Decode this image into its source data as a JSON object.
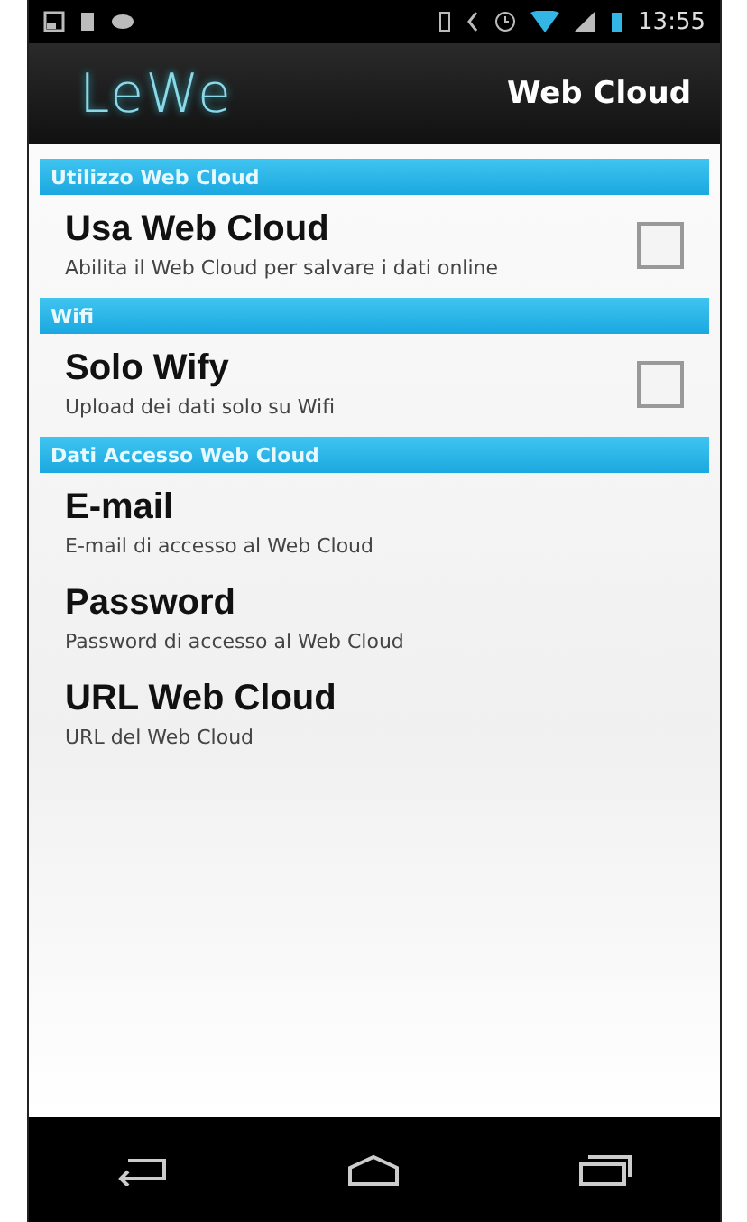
{
  "status_bar": {
    "time": "13:55"
  },
  "action_bar": {
    "logo": "LeWe",
    "title": "Web Cloud"
  },
  "sections": [
    {
      "header": "Utilizzo Web Cloud",
      "items": [
        {
          "kind": "checkbox",
          "title": "Usa Web Cloud",
          "summary": "Abilita il Web Cloud per salvare i dati online",
          "checked": false
        }
      ]
    },
    {
      "header": "Wifi",
      "items": [
        {
          "kind": "checkbox",
          "title": "Solo Wify",
          "summary": "Upload dei dati solo su Wifi",
          "checked": false
        }
      ]
    },
    {
      "header": "Dati Accesso Web Cloud",
      "items": [
        {
          "kind": "text",
          "title": "E-mail",
          "summary": "E-mail di accesso al Web Cloud"
        },
        {
          "kind": "text",
          "title": "Password",
          "summary": "Password di accesso al Web Cloud"
        },
        {
          "kind": "text",
          "title": "URL Web Cloud",
          "summary": "URL del Web Cloud"
        }
      ]
    }
  ]
}
